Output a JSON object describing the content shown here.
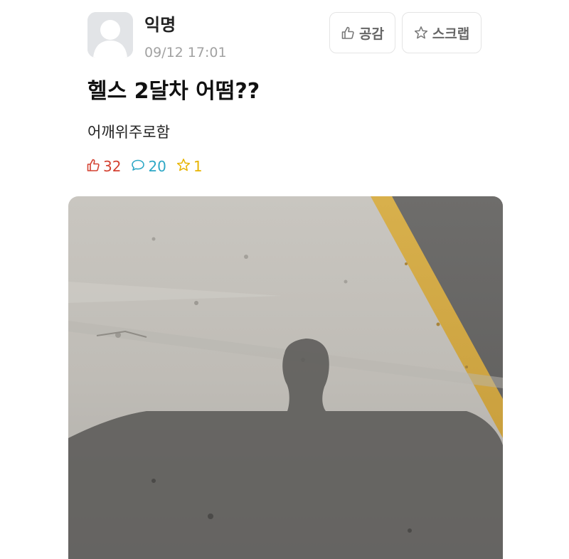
{
  "post": {
    "author": "익명",
    "time": "09/12 17:01",
    "title": "헬스 2달차 어떰??",
    "body": "어깨위주로함"
  },
  "actions": {
    "like_label": "공감",
    "scrap_label": "스크랩"
  },
  "stats": {
    "likes": "32",
    "comments": "20",
    "scraps": "1"
  },
  "icons": {
    "like": "thumbs-up-icon",
    "comment": "speech-bubble-icon",
    "scrap": "star-icon"
  },
  "colors": {
    "like": "#d44131",
    "comment": "#2ea8c6",
    "scrap": "#e8b400",
    "time": "#a2a2a2",
    "button_border": "#e4e4e4"
  }
}
